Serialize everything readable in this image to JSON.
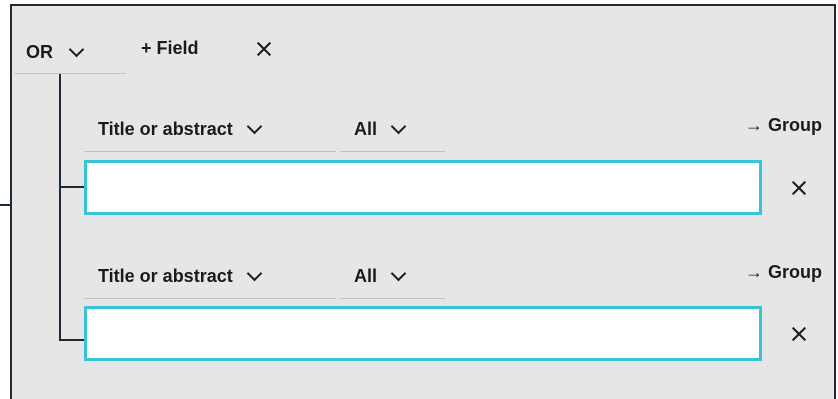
{
  "group": {
    "operator": "OR",
    "add_field_label": "+ Field"
  },
  "rows": [
    {
      "field": "Title or abstract",
      "match": "All",
      "group_link": "→ Group",
      "value": "",
      "placeholder": ""
    },
    {
      "field": "Title or abstract",
      "match": "All",
      "group_link": "→ Group",
      "value": "",
      "placeholder": ""
    }
  ],
  "colors": {
    "panel_bg": "#e6e6e6",
    "border": "#1d2a38",
    "input_focus": "#37c3d8"
  }
}
